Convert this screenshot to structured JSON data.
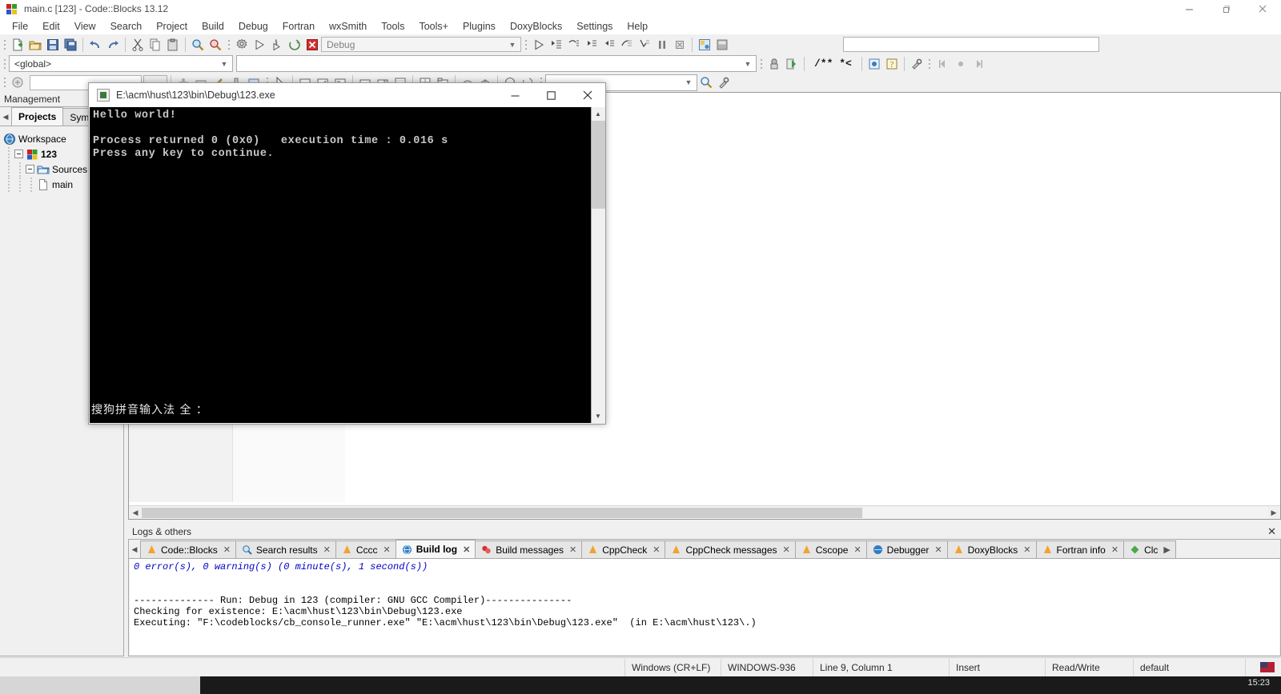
{
  "window": {
    "title": "main.c [123] - Code::Blocks 13.12",
    "app_icon": "codeblocks-icon",
    "minimize": "–",
    "maximize": "❐",
    "close": "✕"
  },
  "menubar": {
    "items": [
      {
        "label": "File"
      },
      {
        "label": "Edit"
      },
      {
        "label": "View"
      },
      {
        "label": "Search"
      },
      {
        "label": "Project"
      },
      {
        "label": "Build"
      },
      {
        "label": "Debug"
      },
      {
        "label": "Fortran"
      },
      {
        "label": "wxSmith"
      },
      {
        "label": "Tools"
      },
      {
        "label": "Tools+"
      },
      {
        "label": "Plugins"
      },
      {
        "label": "DoxyBlocks"
      },
      {
        "label": "Settings"
      },
      {
        "label": "Help"
      }
    ]
  },
  "toolbar": {
    "build_target": "Debug",
    "build_target_placeholder": "Debug",
    "scope_combo": "<global>",
    "scope_placeholder": "<global>",
    "symbol_combo": "",
    "symbol_placeholder": "",
    "search_combo": "",
    "search_placeholder": "",
    "doxy_block_label": "/** *<",
    "buttons": [
      {
        "name": "new-file-icon"
      },
      {
        "name": "open-file-icon"
      },
      {
        "name": "save-icon"
      },
      {
        "name": "save-all-icon"
      },
      {
        "name": "undo-icon"
      },
      {
        "name": "redo-icon"
      },
      {
        "name": "cut-icon"
      },
      {
        "name": "copy-icon"
      },
      {
        "name": "paste-icon"
      },
      {
        "name": "find-icon"
      },
      {
        "name": "replace-icon"
      },
      {
        "name": "build-icon"
      },
      {
        "name": "run-icon"
      },
      {
        "name": "build-and-run-icon"
      },
      {
        "name": "rebuild-icon"
      },
      {
        "name": "abort-icon"
      },
      {
        "name": "debug-continue-icon"
      },
      {
        "name": "run-to-cursor-icon"
      },
      {
        "name": "next-line-icon"
      },
      {
        "name": "step-into-icon"
      },
      {
        "name": "step-out-icon"
      },
      {
        "name": "next-instruction-icon"
      },
      {
        "name": "step-into-instruction-icon"
      },
      {
        "name": "break-debugger-icon"
      },
      {
        "name": "stop-debugger-icon"
      },
      {
        "name": "debugging-windows-icon"
      },
      {
        "name": "various-info-icon"
      }
    ]
  },
  "management": {
    "caption": "Management",
    "tabs": [
      {
        "label": "Projects",
        "active": true
      },
      {
        "label": "Sym",
        "active": false
      }
    ],
    "tree": [
      {
        "label": "Workspace",
        "icon": "workspace-icon",
        "level": 0,
        "bold": false
      },
      {
        "label": "123",
        "icon": "project-icon",
        "level": 1,
        "bold": true
      },
      {
        "label": "Sources",
        "icon": "folder-icon",
        "level": 2,
        "bold": false
      },
      {
        "label": "main",
        "icon": "file-icon",
        "level": 3,
        "bold": false
      }
    ]
  },
  "console": {
    "title": "E:\\acm\\hust\\123\\bin\\Debug\\123.exe",
    "minimize": "—",
    "maximize": "□",
    "close": "✕",
    "lines": [
      "Hello world!",
      "",
      "Process returned 0 (0x0)   execution time : 0.016 s",
      "Press any key to continue."
    ],
    "ime_status": "搜狗拼音输入法 全 ："
  },
  "logs": {
    "caption": "Logs & others",
    "close_label": "✕",
    "tabs": [
      {
        "label": "Code::Blocks",
        "icon": "codeblocks-log-icon",
        "active": false,
        "closable": true
      },
      {
        "label": "Search results",
        "icon": "search-icon",
        "active": false,
        "closable": true
      },
      {
        "label": "Cccc",
        "icon": "cccc-icon",
        "active": false,
        "closable": true
      },
      {
        "label": "Build log",
        "icon": "build-log-icon",
        "active": true,
        "closable": true
      },
      {
        "label": "Build messages",
        "icon": "build-messages-icon",
        "active": false,
        "closable": true
      },
      {
        "label": "CppCheck",
        "icon": "cppcheck-icon",
        "active": false,
        "closable": true
      },
      {
        "label": "CppCheck messages",
        "icon": "cppcheck-messages-icon",
        "active": false,
        "closable": true
      },
      {
        "label": "Cscope",
        "icon": "cscope-icon",
        "active": false,
        "closable": true
      },
      {
        "label": "Debugger",
        "icon": "debugger-icon",
        "active": false,
        "closable": true
      },
      {
        "label": "DoxyBlocks",
        "icon": "doxyblocks-icon",
        "active": false,
        "closable": true
      },
      {
        "label": "Fortran info",
        "icon": "fortran-info-icon",
        "active": false,
        "closable": true
      },
      {
        "label": "Clc",
        "icon": "clc-icon",
        "active": false,
        "closable": false
      }
    ],
    "build_log": [
      {
        "text": "0 error(s), 0 warning(s) (0 minute(s), 1 second(s))",
        "style": "blue"
      },
      {
        "text": "",
        "style": "plain"
      },
      {
        "text": "",
        "style": "plain"
      },
      {
        "text": "-------------- Run: Debug in 123 (compiler: GNU GCC Compiler)---------------",
        "style": "plain"
      },
      {
        "text": "Checking for existence: E:\\acm\\hust\\123\\bin\\Debug\\123.exe",
        "style": "plain"
      },
      {
        "text": "Executing: \"F:\\codeblocks/cb_console_runner.exe\" \"E:\\acm\\hust\\123\\bin\\Debug\\123.exe\"  (in E:\\acm\\hust\\123\\.)",
        "style": "plain"
      }
    ]
  },
  "statusbar": {
    "eol": "Windows (CR+LF)",
    "encoding": "WINDOWS-936",
    "caret": "Line 9, Column 1",
    "insert_mode": "Insert",
    "blank": "",
    "access": "Read/Write",
    "keymap": "default",
    "lang_icon": "us-flag-icon"
  },
  "taskbar": {
    "clock": "15:23"
  },
  "colors": {
    "accent_blue": "#0000c8",
    "console_bg": "#000000",
    "console_fg": "#c8c8c8",
    "chrome": "#f0f0f0"
  }
}
